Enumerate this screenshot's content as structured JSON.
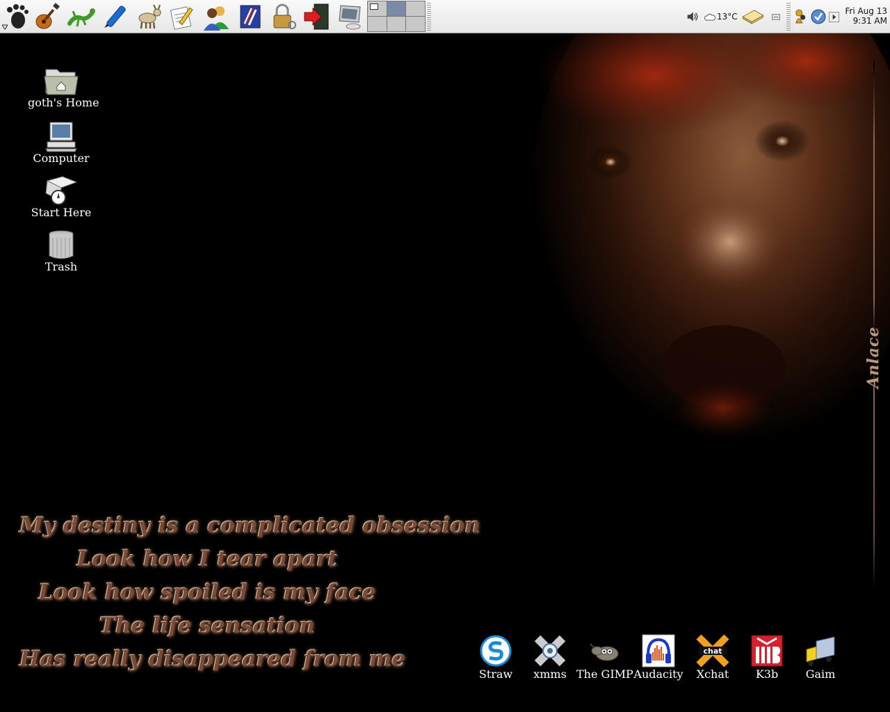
{
  "panel": {
    "launchers": [
      {
        "name": "gnome-foot-menu-icon"
      },
      {
        "name": "guitar-icon"
      },
      {
        "name": "lizard-icon"
      },
      {
        "name": "pen-icon"
      },
      {
        "name": "goat-icon"
      },
      {
        "name": "notepad-pencil-icon"
      },
      {
        "name": "users-icon"
      },
      {
        "name": "book-icon"
      },
      {
        "name": "padlock-icon"
      },
      {
        "name": "logout-arrow-icon"
      },
      {
        "name": "monitor-icon"
      }
    ],
    "workspaces": {
      "count": 6,
      "active_index": 1
    },
    "weather": {
      "temperature": "13°C",
      "icon": "cloud-icon"
    },
    "clock": {
      "date": "Fri Aug 13",
      "time": "9:31 AM"
    }
  },
  "desktop_icons": [
    {
      "label": "goth's Home",
      "icon": "home-folder-icon"
    },
    {
      "label": "Computer",
      "icon": "computer-icon"
    },
    {
      "label": "Start Here",
      "icon": "start-here-icon"
    },
    {
      "label": "Trash",
      "icon": "trash-icon"
    }
  ],
  "app_icons": [
    {
      "label": "Straw",
      "icon": "straw-icon"
    },
    {
      "label": "xmms",
      "icon": "xmms-icon"
    },
    {
      "label": "The GIMP",
      "icon": "gimp-icon"
    },
    {
      "label": "Audacity",
      "icon": "audacity-icon"
    },
    {
      "label": "Xchat",
      "icon": "xchat-icon"
    },
    {
      "label": "K3b",
      "icon": "k3b-icon"
    },
    {
      "label": "Gaim",
      "icon": "gaim-icon"
    }
  ],
  "wallpaper": {
    "band_name": "Anlace",
    "lyrics": [
      "My destiny is a complicated obsession",
      "Look how I tear apart",
      "Look how spoiled is my face",
      "The life sensation",
      "Has really disappeared from me"
    ]
  },
  "colors": {
    "panel_bg": "#eeeeee",
    "desktop_bg": "#000000",
    "lyric_color": "#7a4a38",
    "accent_blue": "#1a66c9"
  }
}
